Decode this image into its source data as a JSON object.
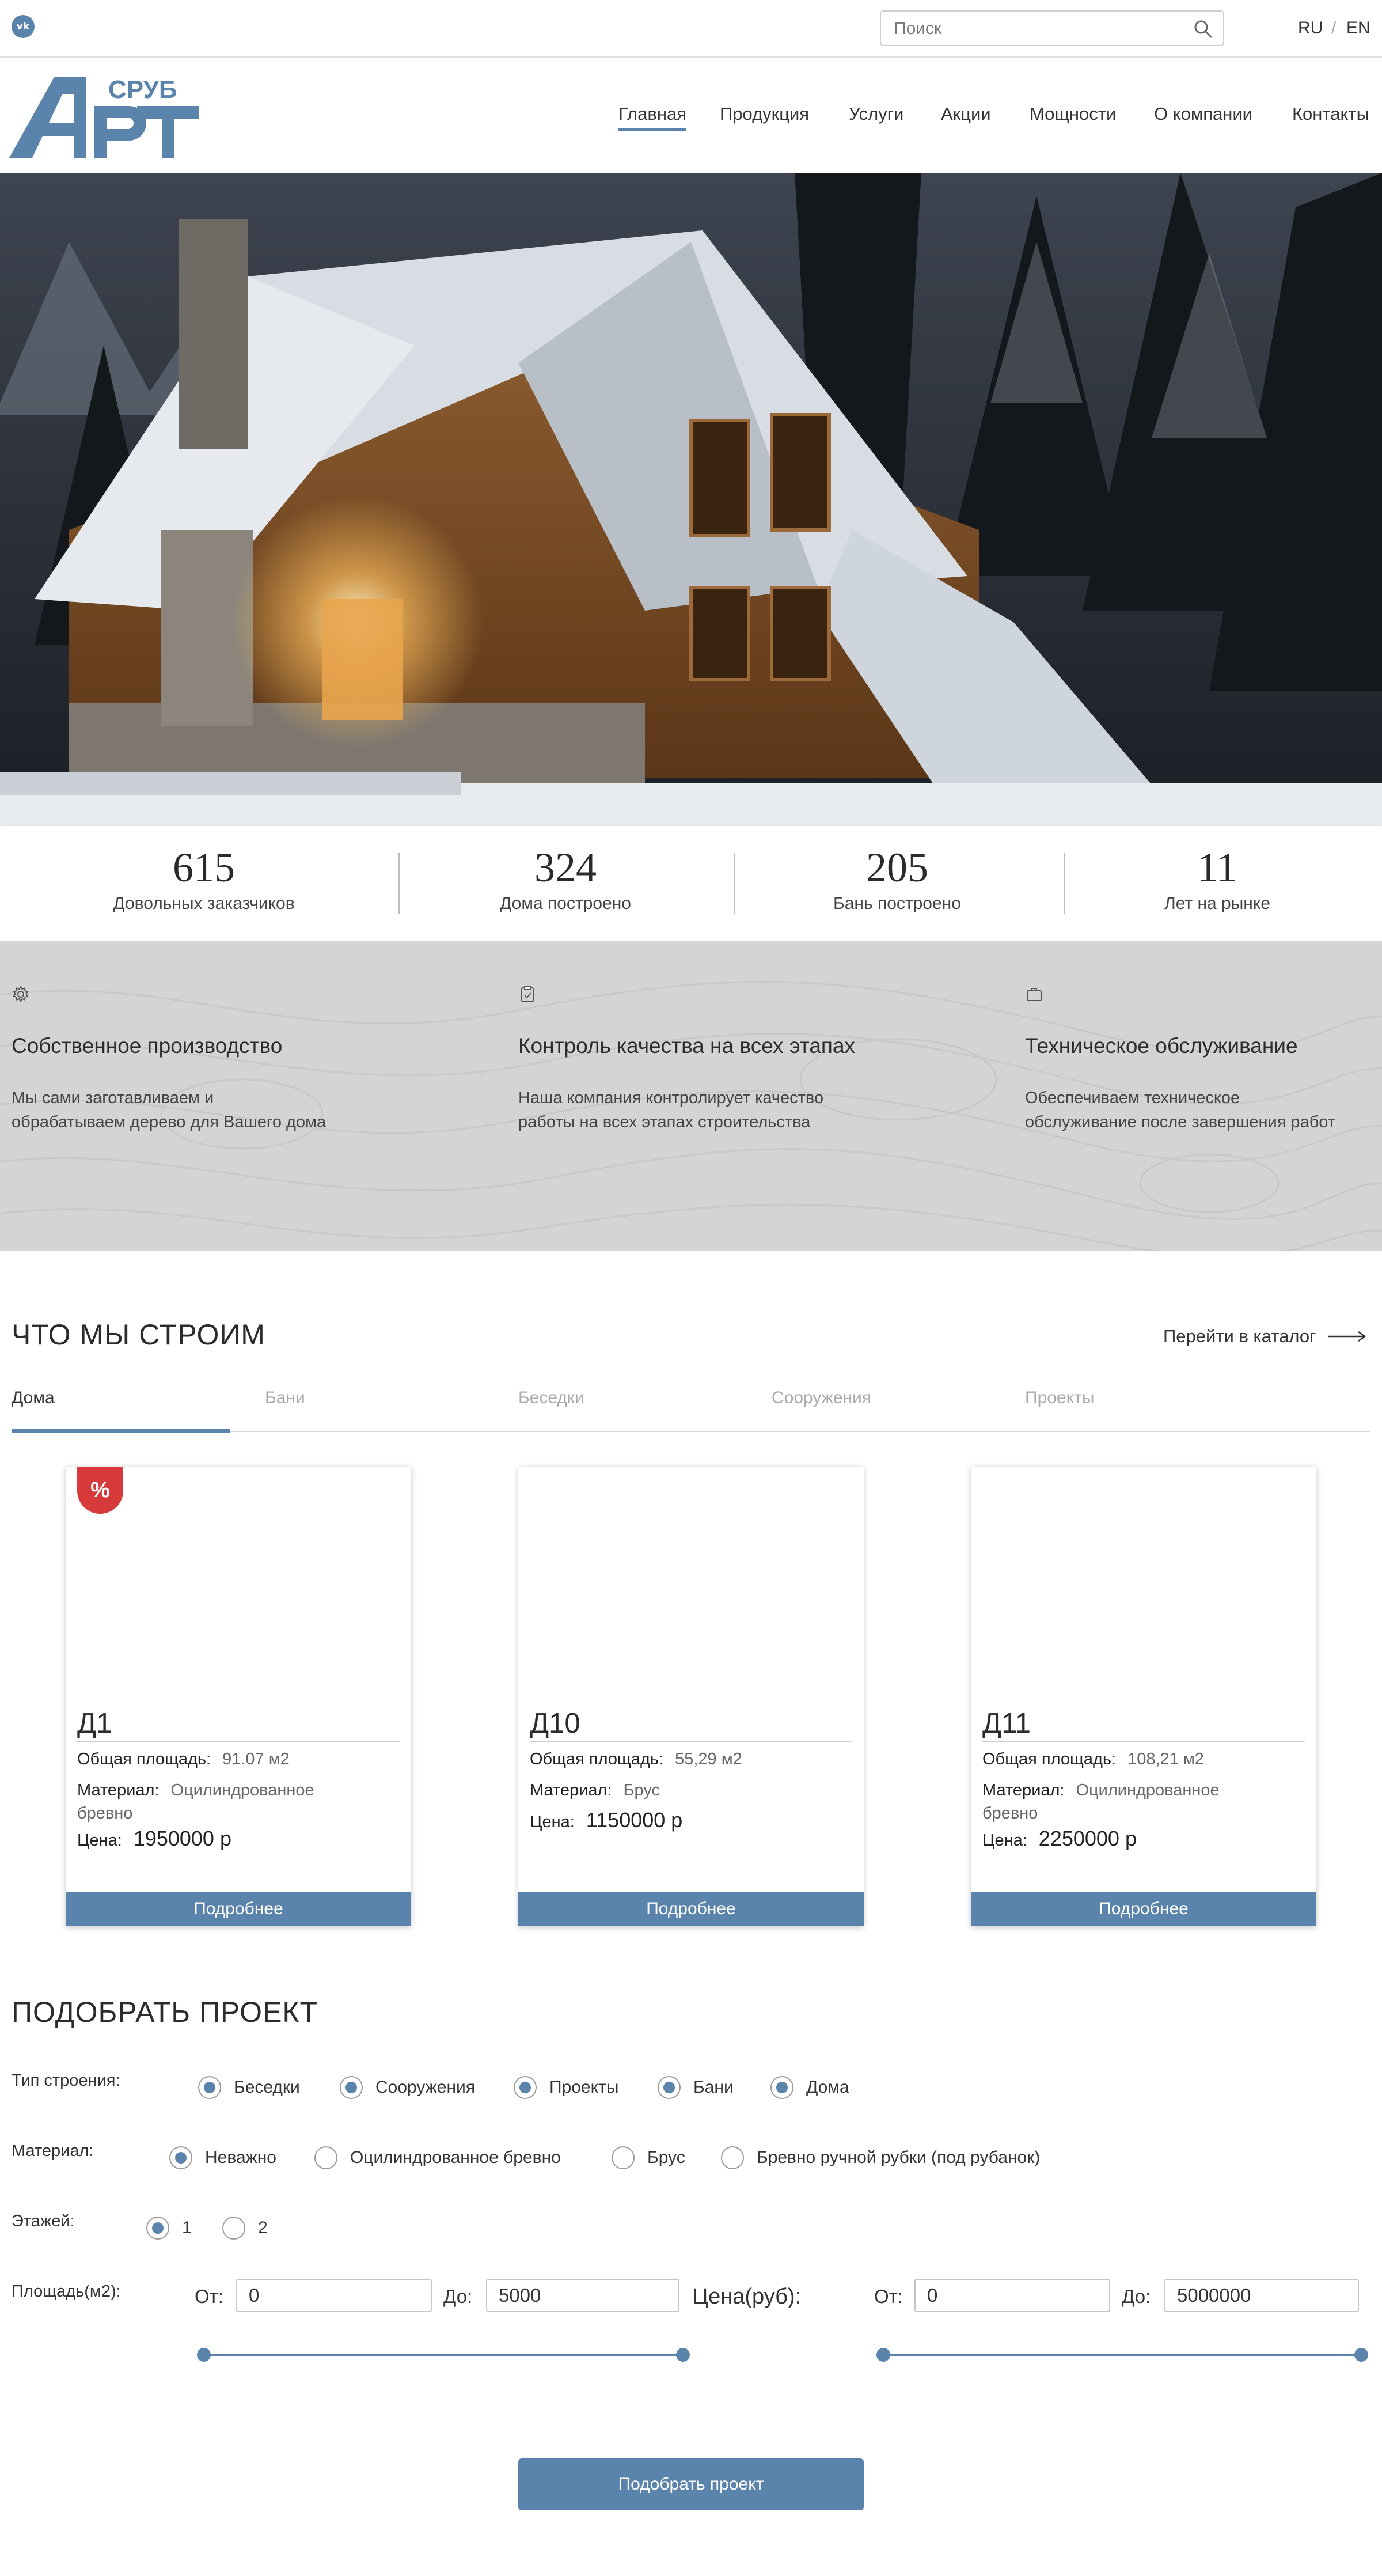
{
  "topbar": {
    "vk_icon": "vk-icon",
    "vk_label": "vk",
    "search": {
      "placeholder": "Поиск",
      "value": ""
    },
    "languages": [
      "RU",
      "EN"
    ],
    "lang_separator": "/"
  },
  "header": {
    "logo_text": "СРУБ",
    "nav": [
      {
        "label": "Главная",
        "active": true
      },
      {
        "label": "Продукция"
      },
      {
        "label": "Услуги"
      },
      {
        "label": "Акции"
      },
      {
        "label": "Мощности"
      },
      {
        "label": "О компании"
      },
      {
        "label": "Контакты"
      }
    ]
  },
  "stats": [
    {
      "value": "615",
      "label": "Довольных заказчиков"
    },
    {
      "value": "324",
      "label": "Дома построено"
    },
    {
      "value": "205",
      "label": "Бань построено"
    },
    {
      "value": "11",
      "label": "Лет на рынке"
    }
  ],
  "features": [
    {
      "icon": "gear-icon",
      "title": "Собственное производство",
      "text_line1": "Мы сами заготавливаем и",
      "text_line2": "обрабатываем дерево для Вашего дома"
    },
    {
      "icon": "clipboard-check-icon",
      "title": "Контроль качества на всех этапах",
      "text_line1": "Наша компания контролирует качество",
      "text_line2": "работы на всех этапах строительства"
    },
    {
      "icon": "briefcase-icon",
      "title": "Техническое обслуживание",
      "text_line1": "Обеспечиваем техническое",
      "text_line2": "обслуживание после завершения работ"
    }
  ],
  "build": {
    "title": "ЧТО МЫ СТРОИМ",
    "catalog_link": "Перейти в каталог",
    "tabs": [
      "Дома",
      "Бани",
      "Беседки",
      "Сооружения",
      "Проекты"
    ],
    "active_tab": "Дома",
    "area_label": "Общая площадь:",
    "material_label": "Материал:",
    "price_label": "Цена:",
    "more_label": "Подробнее",
    "cards": [
      {
        "name": "Д1",
        "area": "91.07 м2",
        "material_line1": "Оцилиндрованное",
        "material_line2": "бревно",
        "price": "1950000 р",
        "badge": "%"
      },
      {
        "name": "Д10",
        "area": "55,29 м2",
        "material_line1": "Брус",
        "material_line2": "",
        "price": "1150000 р",
        "badge": ""
      },
      {
        "name": "Д11",
        "area": "108,21 м2",
        "material_line1": "Оцилиндрованное",
        "material_line2": "бревно",
        "price": "2250000 р",
        "badge": ""
      }
    ]
  },
  "selector": {
    "title": "ПОДОБРАТЬ ПРОЕКТ",
    "type_label": "Тип строения:",
    "types": [
      "Беседки",
      "Сооружения",
      "Проекты",
      "Бани",
      "Дома"
    ],
    "material_label": "Материал:",
    "materials": [
      "Неважно",
      "Оцилиндрованное бревно",
      "Брус",
      "Бревно ручной рубки (под рубанок)"
    ],
    "material_selected": "Неважно",
    "floors_label": "Этажей:",
    "floors": [
      "1",
      "2"
    ],
    "floors_selected": "1",
    "area_label": "Площадь(м2):",
    "from_label": "От:",
    "to_label": "До:",
    "area_from": "0",
    "area_to": "5000",
    "price_label": "Цена(руб):",
    "price_from": "0",
    "price_to": "5000000",
    "area_range_fraction": [
      0,
      1
    ],
    "price_range_fraction": [
      0,
      1
    ],
    "submit_label": "Подобрать проект"
  },
  "colors": {
    "accent": "#5b84ac",
    "badge": "#d63a3a",
    "features_bg": "#d4d4d4"
  }
}
